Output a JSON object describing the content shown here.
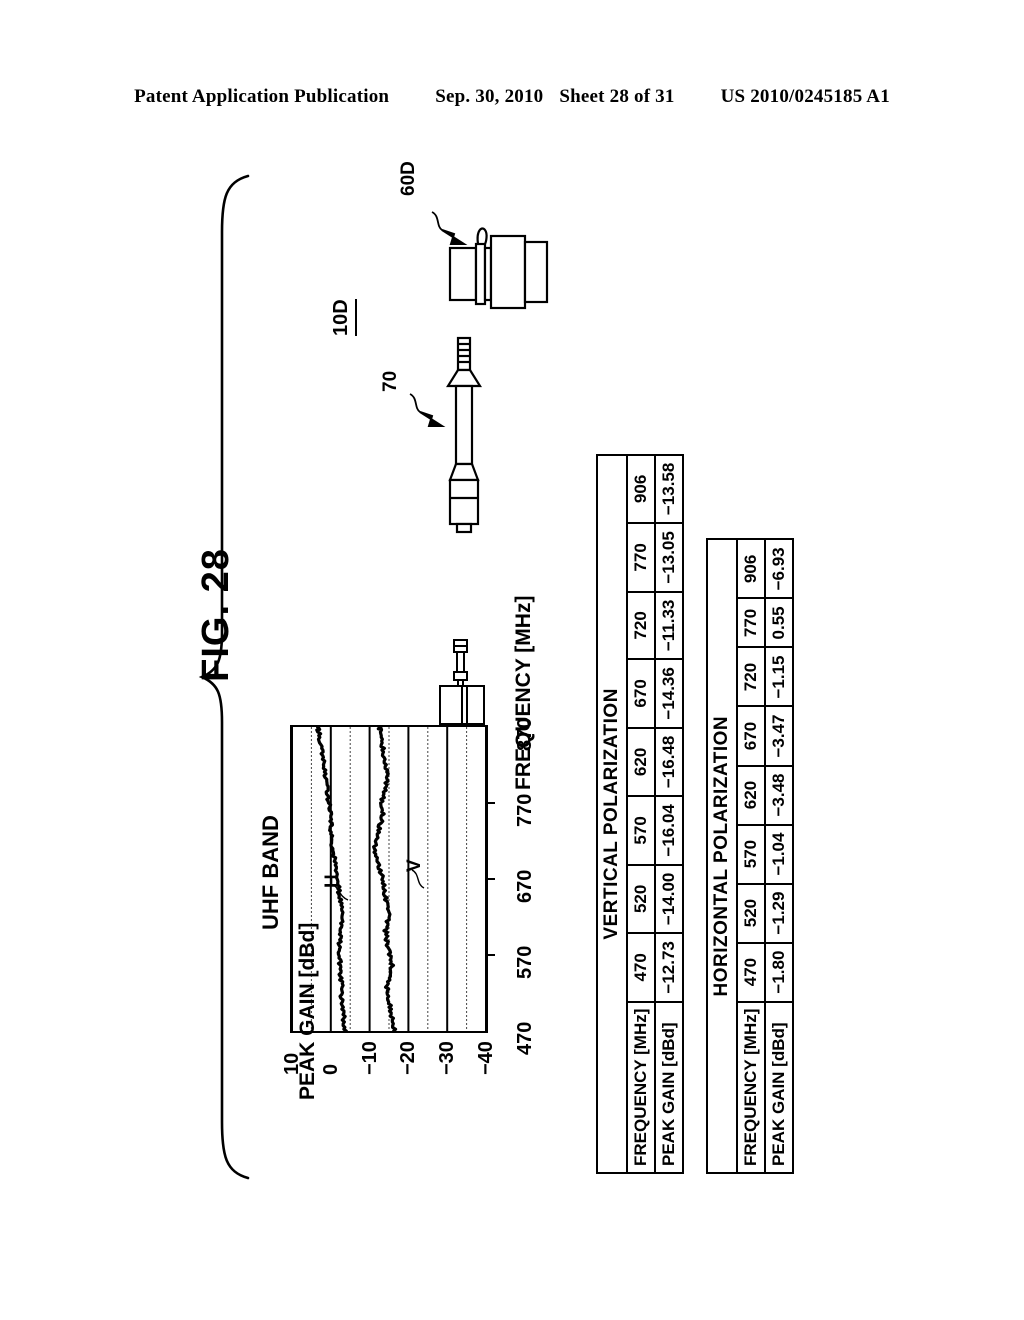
{
  "header": {
    "publication": "Patent Application Publication",
    "date": "Sep. 30, 2010",
    "sheet": "Sheet 28 of 31",
    "patent_number": "US 2010/0245185 A1"
  },
  "figure": {
    "caption": "FIG. 28"
  },
  "device": {
    "assembly_label": "10D",
    "connector_label": "60D",
    "cable_label": "70"
  },
  "chart_data": {
    "type": "line",
    "title": "UHF BAND",
    "xlabel": "FREQUENCY [MHz]",
    "ylabel": "PEAK GAIN [dBd]",
    "xlim": [
      470,
      870
    ],
    "ylim": [
      -40,
      10
    ],
    "xticks": [
      470,
      570,
      670,
      770,
      870
    ],
    "yticks": [
      10,
      0,
      -10,
      -20,
      -30,
      -40
    ],
    "grid": true,
    "legend": "inline-annotation",
    "series": [
      {
        "name": "H",
        "label": "H",
        "x": [
          470,
          482,
          494,
          506,
          518,
          530,
          542,
          554,
          566,
          578,
          590,
          602,
          614,
          626,
          638,
          650,
          662,
          674,
          686,
          698,
          710,
          722,
          734,
          746,
          758,
          770,
          782,
          794,
          806,
          818,
          830,
          842,
          854,
          866,
          870
        ],
        "values": [
          -3.6,
          -3.2,
          -3.4,
          -2.9,
          -2.6,
          -2.9,
          -2.4,
          -2.2,
          -2.5,
          -2.1,
          -2.4,
          -2.7,
          -3.0,
          -2.8,
          -2.5,
          -2.2,
          -1.9,
          -1.6,
          -1.3,
          -0.9,
          -0.5,
          -0.2,
          0.1,
          -0.1,
          0.2,
          0.5,
          0.8,
          1.1,
          1.5,
          1.8,
          2.1,
          2.5,
          2.8,
          3.2,
          3.4
        ]
      },
      {
        "name": "V",
        "label": "V",
        "x": [
          470,
          482,
          494,
          506,
          518,
          530,
          542,
          554,
          566,
          578,
          590,
          602,
          614,
          626,
          638,
          650,
          662,
          674,
          686,
          698,
          710,
          722,
          734,
          746,
          758,
          770,
          782,
          794,
          806,
          818,
          830,
          842,
          854,
          866,
          870
        ],
        "values": [
          -16.4,
          -16.1,
          -15.6,
          -15.2,
          -14.8,
          -14.3,
          -15.3,
          -15.8,
          -15.4,
          -14.9,
          -14.4,
          -14.1,
          -14.6,
          -14.9,
          -14.4,
          -14.0,
          -13.6,
          -13.1,
          -12.4,
          -11.7,
          -11.3,
          -11.6,
          -12.3,
          -13.0,
          -13.4,
          -13.1,
          -13.6,
          -14.2,
          -14.6,
          -14.2,
          -13.8,
          -13.4,
          -13.0,
          -12.7,
          -12.5
        ]
      }
    ]
  },
  "tables": [
    {
      "title": "VERTICAL POLARIZATION",
      "rows": [
        {
          "header": "FREQUENCY [MHz]",
          "cells": [
            "470",
            "520",
            "570",
            "620",
            "670",
            "720",
            "770",
            "906"
          ]
        },
        {
          "header": "PEAK GAIN [dBd]",
          "cells": [
            "−12.73",
            "−14.00",
            "−16.04",
            "−16.48",
            "−14.36",
            "−11.33",
            "−13.05",
            "−13.58"
          ]
        }
      ]
    },
    {
      "title": "HORIZONTAL POLARIZATION",
      "rows": [
        {
          "header": "FREQUENCY [MHz]",
          "cells": [
            "470",
            "520",
            "570",
            "620",
            "670",
            "720",
            "770",
            "906"
          ]
        },
        {
          "header": "PEAK GAIN [dBd]",
          "cells": [
            "−1.80",
            "−1.29",
            "−1.04",
            "−3.48",
            "−3.47",
            "−1.15",
            "0.55",
            "−6.93"
          ]
        }
      ]
    }
  ],
  "icons": {
    "brace": "curly-brace",
    "connector": "coaxial-connector",
    "cable": "antenna-cable",
    "antenna": "small-antenna"
  },
  "colors": {
    "ink": "#000000",
    "paper": "#ffffff"
  }
}
